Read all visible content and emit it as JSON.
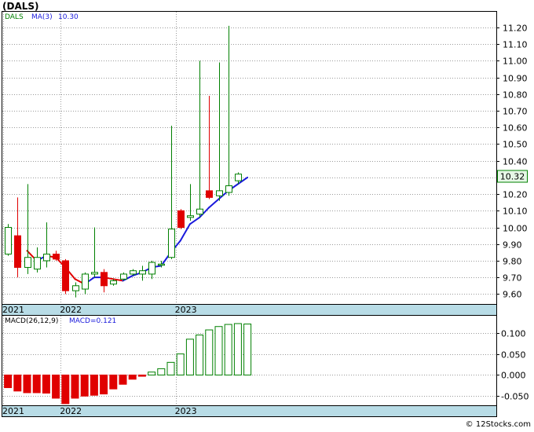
{
  "title": "(DALS)",
  "footer": "© 12Stocks.com",
  "colors": {
    "up": "#008000",
    "down": "#e00000",
    "ma": "#1a1adc",
    "grid": "#9a9a9a",
    "axisband": "#b8dce6",
    "pricelabel_bg": "#e6f7e6"
  },
  "chart_data": [
    {
      "type": "candlestick",
      "name": "price",
      "legend": {
        "ticker": "DALS",
        "ma_label": "MA(3)",
        "ma_value": "10.30"
      },
      "current_price_label": "10.32",
      "current_price": 10.32,
      "ylim": [
        9.55,
        11.28
      ],
      "y_ticks": [
        9.6,
        9.7,
        9.8,
        9.9,
        10.0,
        10.1,
        10.2,
        10.3,
        10.4,
        10.5,
        10.6,
        10.7,
        10.8,
        10.9,
        11.0,
        11.1,
        11.2
      ],
      "y_tick_labels": [
        "9.60",
        "9.70",
        "9.80",
        "9.90",
        "10.00",
        "10.10",
        "10.20",
        "10.30",
        "10.40",
        "10.50",
        "10.60",
        "10.70",
        "10.80",
        "10.90",
        "11.00",
        "11.10",
        "11.20"
      ],
      "x_labels": [
        {
          "label": "2021",
          "index": 0
        },
        {
          "label": "2022",
          "index": 6
        },
        {
          "label": "2023",
          "index": 18
        }
      ],
      "candles": [
        {
          "o": 9.84,
          "h": 10.02,
          "l": 9.83,
          "c": 10.0
        },
        {
          "o": 9.95,
          "h": 10.18,
          "l": 9.7,
          "c": 9.76
        },
        {
          "o": 9.76,
          "h": 10.26,
          "l": 9.72,
          "c": 9.82
        },
        {
          "o": 9.75,
          "h": 9.88,
          "l": 9.73,
          "c": 9.82
        },
        {
          "o": 9.8,
          "h": 10.03,
          "l": 9.76,
          "c": 9.84
        },
        {
          "o": 9.84,
          "h": 9.86,
          "l": 9.8,
          "c": 9.81
        },
        {
          "o": 9.8,
          "h": 9.81,
          "l": 9.6,
          "c": 9.62
        },
        {
          "o": 9.62,
          "h": 9.67,
          "l": 9.58,
          "c": 9.65
        },
        {
          "o": 9.63,
          "h": 9.73,
          "l": 9.6,
          "c": 9.72
        },
        {
          "o": 9.72,
          "h": 10.0,
          "l": 9.7,
          "c": 9.73
        },
        {
          "o": 9.73,
          "h": 9.75,
          "l": 9.61,
          "c": 9.65
        },
        {
          "o": 9.66,
          "h": 9.69,
          "l": 9.65,
          "c": 9.68
        },
        {
          "o": 9.69,
          "h": 9.73,
          "l": 9.68,
          "c": 9.72
        },
        {
          "o": 9.72,
          "h": 9.75,
          "l": 9.71,
          "c": 9.74
        },
        {
          "o": 9.72,
          "h": 9.77,
          "l": 9.68,
          "c": 9.74
        },
        {
          "o": 9.72,
          "h": 9.8,
          "l": 9.69,
          "c": 9.79
        },
        {
          "o": 9.78,
          "h": 9.8,
          "l": 9.76,
          "c": 9.78
        },
        {
          "o": 9.82,
          "h": 10.61,
          "l": 9.81,
          "c": 9.99
        },
        {
          "o": 10.1,
          "h": 10.11,
          "l": 9.99,
          "c": 10.0
        },
        {
          "o": 10.06,
          "h": 10.26,
          "l": 10.04,
          "c": 10.07
        },
        {
          "o": 10.08,
          "h": 11.0,
          "l": 10.06,
          "c": 10.11
        },
        {
          "o": 10.22,
          "h": 10.79,
          "l": 10.17,
          "c": 10.18
        },
        {
          "o": 10.19,
          "h": 10.99,
          "l": 10.16,
          "c": 10.22
        },
        {
          "o": 10.21,
          "h": 11.21,
          "l": 10.19,
          "c": 10.25
        },
        {
          "o": 10.28,
          "h": 10.33,
          "l": 10.26,
          "c": 10.32
        }
      ],
      "ma": [
        null,
        null,
        9.86,
        9.8,
        9.83,
        9.82,
        9.76,
        9.69,
        9.66,
        9.7,
        9.7,
        9.69,
        9.68,
        9.71,
        9.73,
        9.76,
        9.77,
        9.85,
        9.92,
        10.02,
        10.06,
        10.12,
        10.17,
        10.22,
        10.26,
        10.3
      ]
    },
    {
      "type": "bar",
      "name": "macd",
      "legend": {
        "label": "MACD(26,12,9)",
        "value_label": "MACD=0.121"
      },
      "ylim": [
        -0.07,
        0.135
      ],
      "y_ticks": [
        -0.05,
        0.0,
        0.05,
        0.1
      ],
      "y_tick_labels": [
        "-0.050",
        "0.000",
        "0.050",
        "0.100"
      ],
      "x_labels": [
        {
          "label": "2021",
          "index": 0
        },
        {
          "label": "2022",
          "index": 6
        },
        {
          "label": "2023",
          "index": 18
        }
      ],
      "values": [
        -0.03,
        -0.038,
        -0.042,
        -0.042,
        -0.043,
        -0.055,
        -0.068,
        -0.055,
        -0.05,
        -0.048,
        -0.045,
        -0.033,
        -0.022,
        -0.01,
        -0.003,
        0.007,
        0.015,
        0.03,
        0.05,
        0.085,
        0.095,
        0.107,
        0.115,
        0.12,
        0.122,
        0.121
      ]
    }
  ]
}
